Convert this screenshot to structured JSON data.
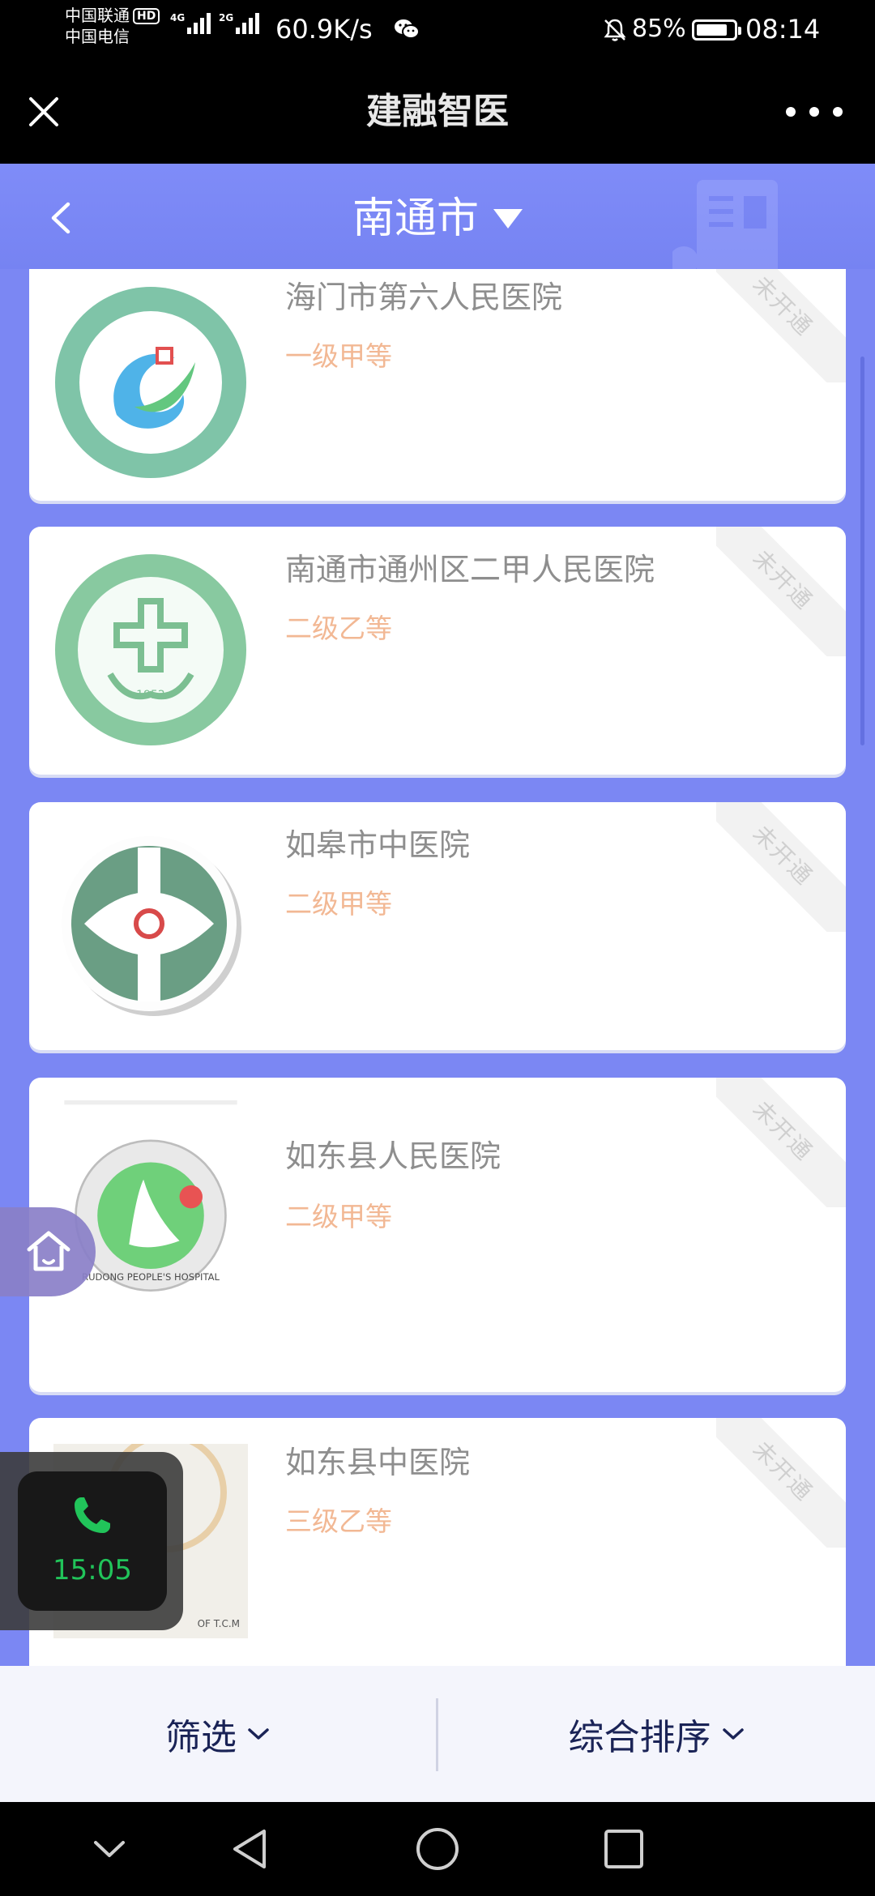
{
  "status_bar": {
    "carrier_1": "中国联通",
    "hd": "HD",
    "carrier_2": "中国电信",
    "net_1": "4G",
    "net_2": "2G",
    "speed": "60.9K/s",
    "battery": "85%",
    "battery_level": 0.85,
    "time": "08:14"
  },
  "title_bar": {
    "title": "建融智医"
  },
  "header": {
    "city": "南通市"
  },
  "hospitals": [
    {
      "name": "海门市第六人民医院",
      "level": "一级甲等",
      "status": "未开通"
    },
    {
      "name": "南通市通州区二甲人民医院",
      "level": "二级乙等",
      "status": "未开通",
      "logo_text": "1952"
    },
    {
      "name": "如皋市中医院",
      "level": "二级甲等",
      "status": "未开通"
    },
    {
      "name": "如东县人民医院",
      "level": "二级甲等",
      "status": "未开通",
      "logo_text": "RUDONG PEOPLE'S HOSPITAL"
    },
    {
      "name": "如东县中医院",
      "level": "三级乙等",
      "status": "未开通",
      "logo_text": "OF T.C.M"
    }
  ],
  "call_widget": {
    "timer": "15:05"
  },
  "filter_bar": {
    "filter_label": "筛选",
    "sort_label": "综合排序"
  },
  "colors": {
    "accent": "#7b87f3",
    "level_text": "#f2b894",
    "call_green": "#21c45a"
  }
}
